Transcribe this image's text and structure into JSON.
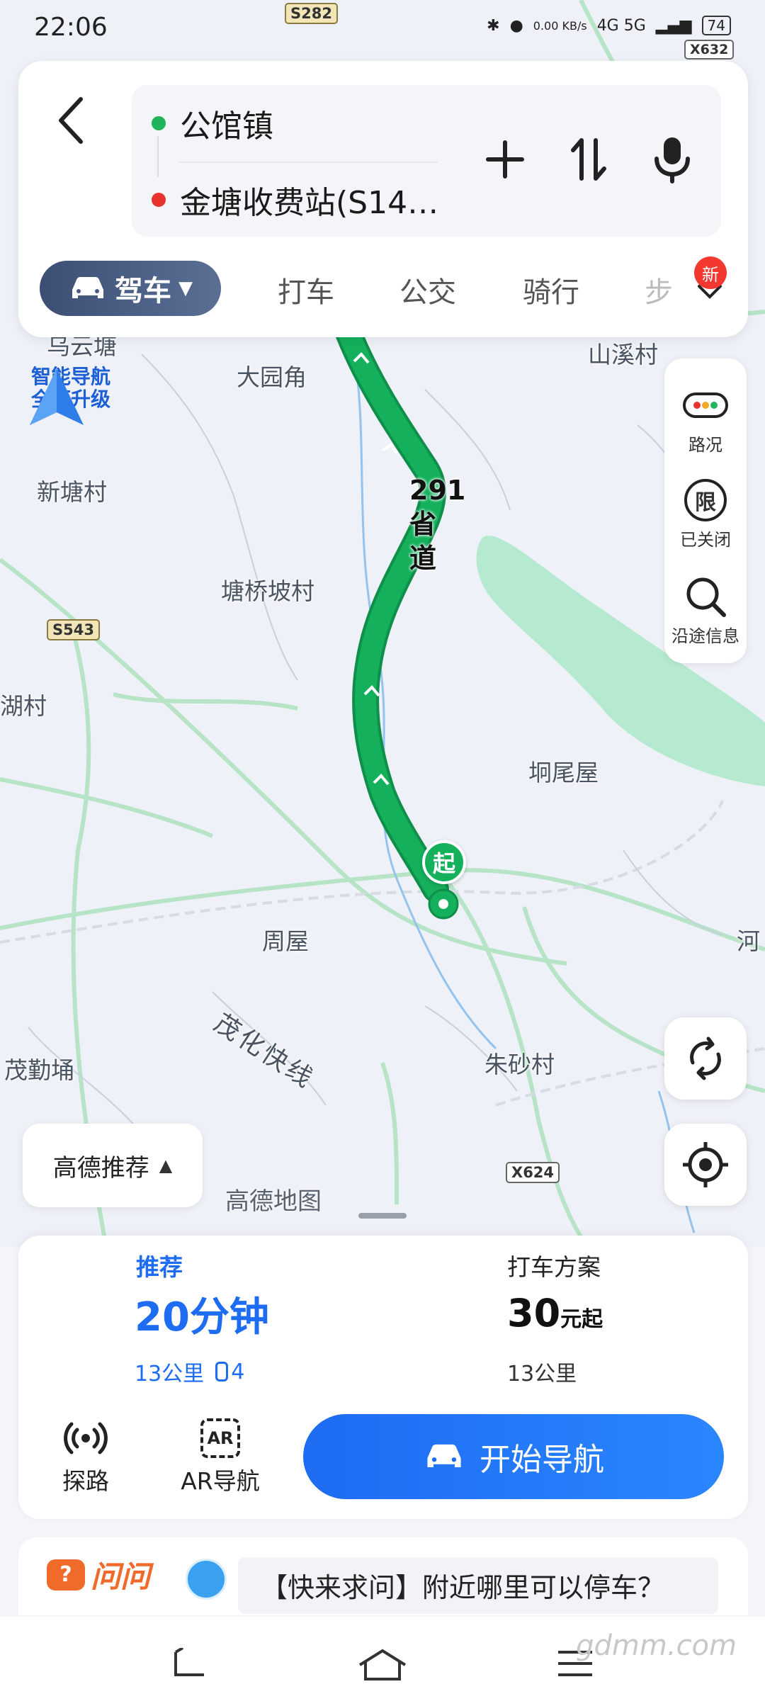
{
  "status_bar": {
    "time": "22:06",
    "net_speed": "0.00 KB/s",
    "network": "4G 5G",
    "battery": "74"
  },
  "search": {
    "origin": "公馆镇",
    "destination": "金塘收费站(S14…",
    "colors": {
      "origin_dot": "#1fb35a",
      "destination_dot": "#e9332e"
    }
  },
  "modes": {
    "active": "驾车",
    "items": [
      "打车",
      "公交",
      "骑行",
      "步"
    ],
    "new_badge": "新"
  },
  "map": {
    "places": [
      "乌云塘",
      "大园角",
      "山溪村",
      "新塘村",
      "塘桥坡村",
      "湖村",
      "坰尾屋",
      "周屋",
      "茂化快线",
      "茂勤埇",
      "朱砂村",
      "河",
      "高德地图"
    ],
    "road_numbers": [
      "S282",
      "X632",
      "S543",
      "X624"
    ],
    "route_name": "291省道",
    "start_marker": "起",
    "ai_nav": {
      "line1": "智能导航",
      "line2": "全面升级"
    },
    "route_color": "#14b05c",
    "water_color": "#b6ead0"
  },
  "right_panel": {
    "traffic": "路况",
    "restriction": "已关闭",
    "restriction_icon": "限",
    "along_route": "沿途信息"
  },
  "recommend_filter": "高德推荐",
  "route_summary": {
    "tag": "推荐",
    "duration": "20分钟",
    "distance": "13公里",
    "traffic_lights": "4",
    "taxi_title": "打车方案",
    "taxi_price": "30",
    "taxi_price_unit": "元起",
    "taxi_distance": "13公里"
  },
  "tools": {
    "explore": "探路",
    "ar": "AR导航",
    "ar_icon": "AR"
  },
  "start_navigation": "开始导航",
  "ask": {
    "brand": "问问",
    "question": "【快来求问】附近哪里可以停车？"
  },
  "watermark": "gdmm.com"
}
